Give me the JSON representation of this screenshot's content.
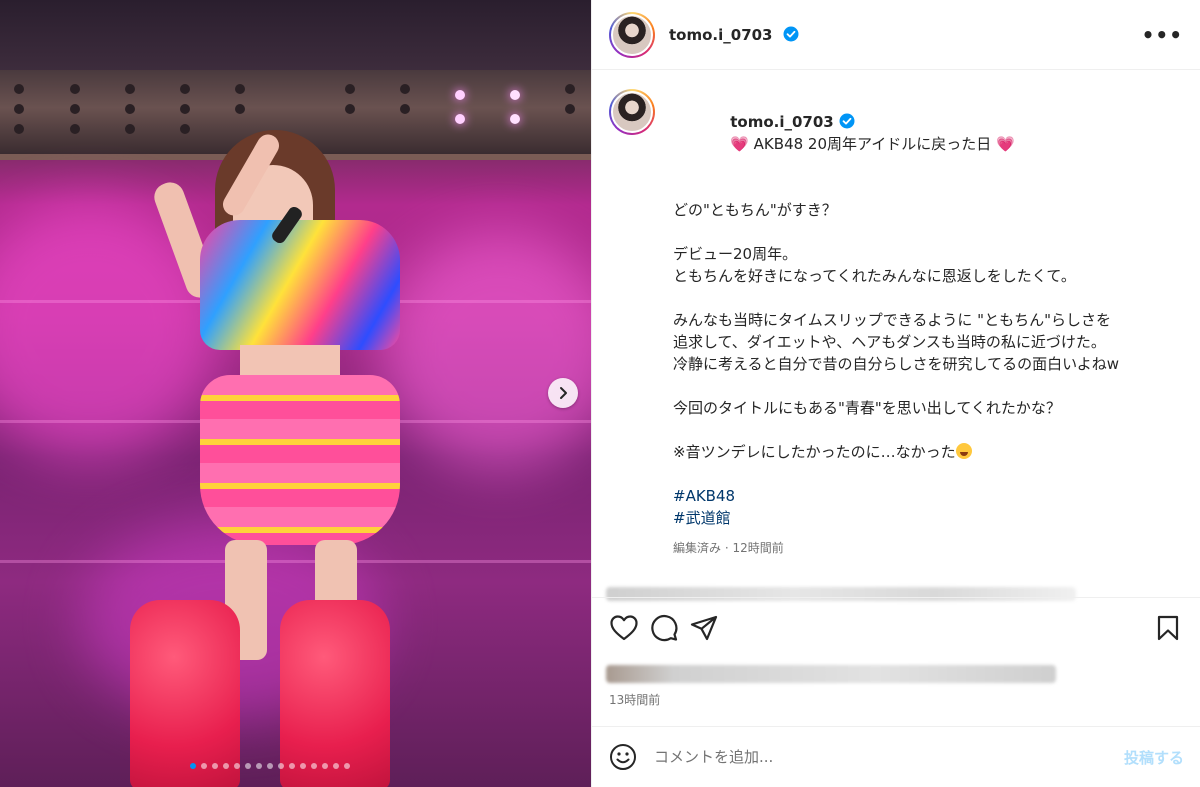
{
  "post": {
    "username": "tomo.i_0703",
    "caption_title": " AKB48 20周年アイドルに戻った日 ",
    "caption_lines": [
      "どの\"ともちん\"がすき？",
      "",
      "デビュー20周年。",
      "ともちんを好きになってくれたみんなに恩返しをしたくて。",
      "",
      "みんなも当時にタイムスリップできるように \"ともちん\"らしさを",
      "追求して、ダイエットや、ヘアもダンスも当時の私に近づけた。",
      "冷静に考えると自分で昔の自分らしさを研究してるの面白いよねw",
      "",
      "今回のタイトルにもある\"青春\"を思い出してくれたかな？",
      "",
      "※音ツンデレにしたかったのに…なかった"
    ],
    "hashtags": [
      "#AKB48",
      "#武道館"
    ],
    "caption_meta": "編集済み · 12時間前",
    "timestamp": "13時間前"
  },
  "comment_box": {
    "placeholder": "コメントを追加...",
    "post_label": "投稿する"
  },
  "carousel": {
    "dot_count": 15,
    "active_index": 0
  },
  "colors": {
    "accent": "#0095f6",
    "heart": "#ff3d8b",
    "link": "#00376b"
  },
  "icons": [
    "verified-badge-icon",
    "more-options-icon",
    "heart-icon",
    "comment-icon",
    "share-icon",
    "bookmark-icon",
    "emoji-icon",
    "chevron-right-icon"
  ]
}
